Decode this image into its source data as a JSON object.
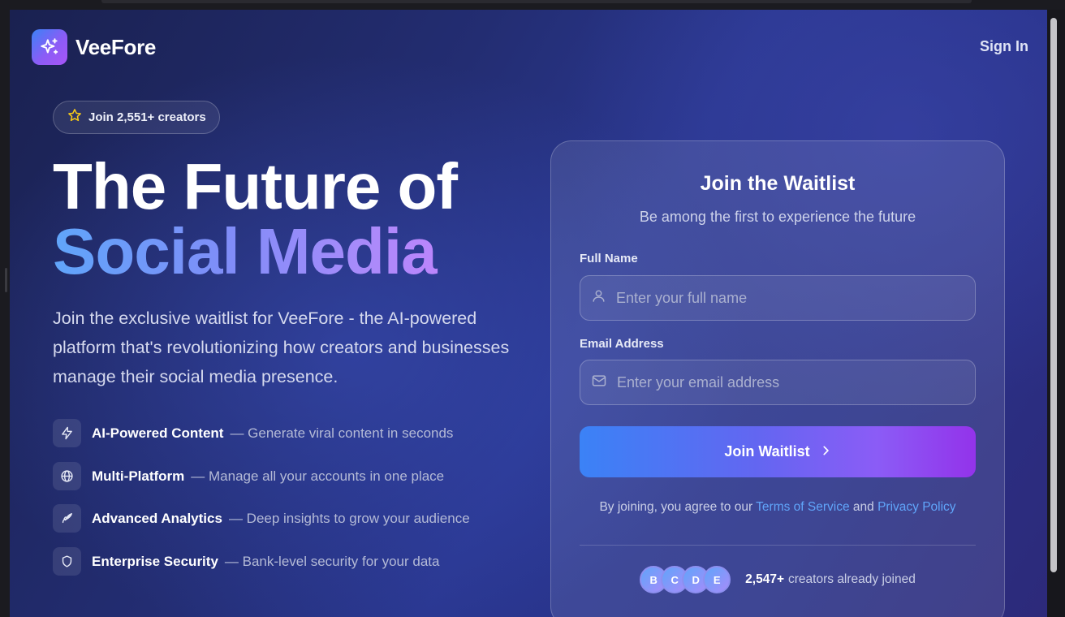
{
  "brand": {
    "name": "VeeFore",
    "logo_icon": "sparkles-icon"
  },
  "nav": {
    "signin_label": "Sign In"
  },
  "badge": {
    "icon": "star-icon",
    "text": "Join 2,551+ creators"
  },
  "hero": {
    "line1": "The Future of",
    "line2": "Social Media",
    "description": "Join the exclusive waitlist for VeeFore - the AI-powered platform that's revolutionizing how creators and businesses manage their social media presence."
  },
  "features": [
    {
      "icon": "lightning-icon",
      "title": "AI-Powered Content",
      "desc": "— Generate viral content in seconds"
    },
    {
      "icon": "globe-icon",
      "title": "Multi-Platform",
      "desc": "— Manage all your accounts in one place"
    },
    {
      "icon": "rocket-icon",
      "title": "Advanced Analytics",
      "desc": "— Deep insights to grow your audience"
    },
    {
      "icon": "shield-icon",
      "title": "Enterprise Security",
      "desc": "— Bank-level security for your data"
    }
  ],
  "form": {
    "title": "Join the Waitlist",
    "subtitle": "Be among the first to experience the future",
    "name_label": "Full Name",
    "name_placeholder": "Enter your full name",
    "name_value": "",
    "email_label": "Email Address",
    "email_placeholder": "Enter your email address",
    "email_value": "",
    "submit_label": "Join Waitlist",
    "terms_prefix": "By joining, you agree to our",
    "terms_link": "Terms of Service",
    "terms_and": "and",
    "privacy_link": "Privacy Policy",
    "avatars": [
      "B",
      "C",
      "D",
      "E"
    ],
    "joined_count": "2,547+",
    "joined_text": "creators already joined"
  },
  "colors": {
    "accent_blue": "#3b82f6",
    "accent_purple": "#9333ea",
    "link": "#60a5fa",
    "star": "#facc15"
  }
}
